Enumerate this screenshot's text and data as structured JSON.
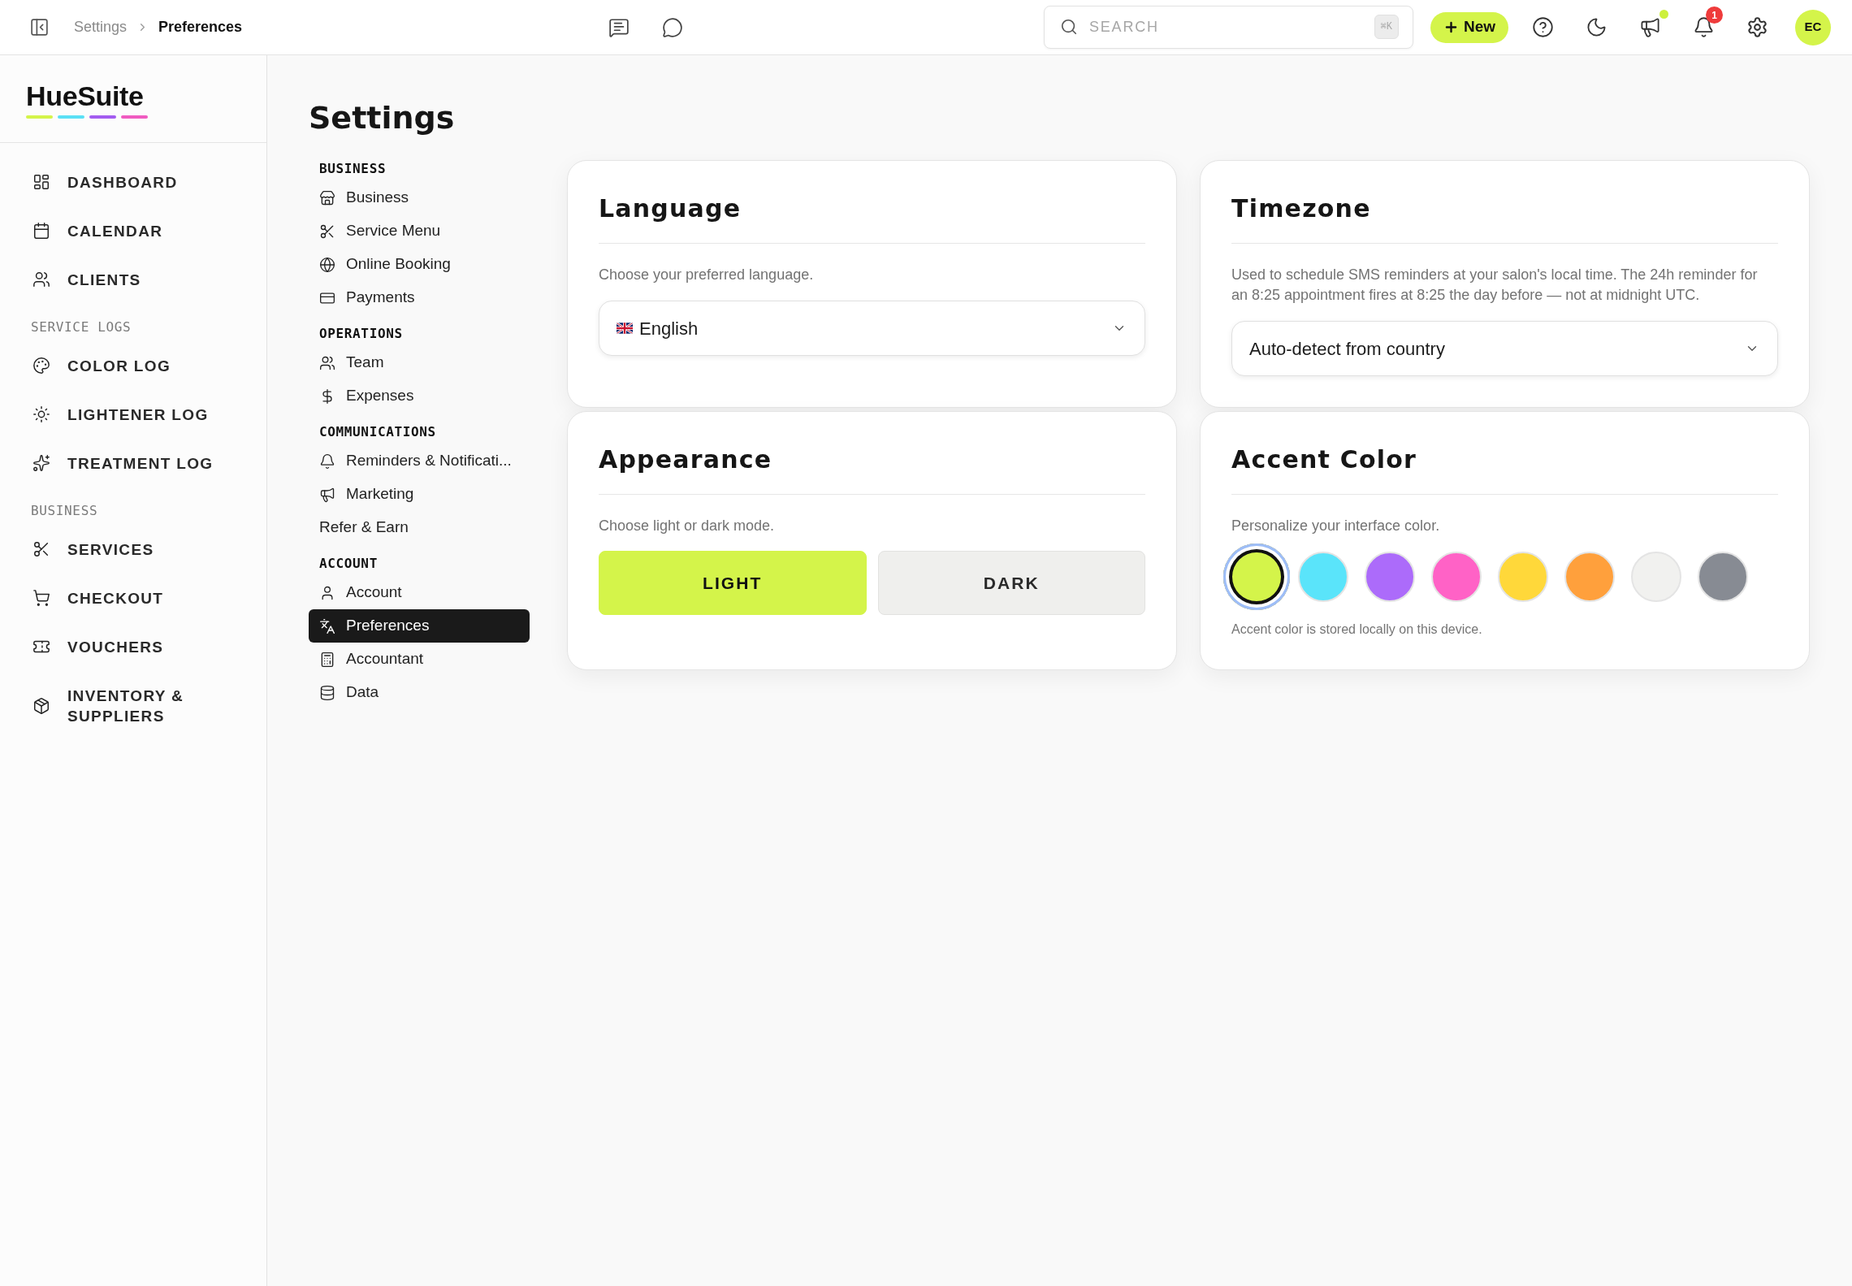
{
  "topbar": {
    "breadcrumb": [
      {
        "label": "Settings",
        "current": false
      },
      {
        "label": "Preferences",
        "current": true
      }
    ],
    "search": {
      "placeholder": "SEARCH",
      "shortcut": "⌘K"
    },
    "new_button": "New",
    "announcements": {
      "unread": true
    },
    "notifications": {
      "count": "1"
    },
    "avatar": "EC"
  },
  "sidebar": {
    "logo": "HueSuite",
    "sections": [
      {
        "items": [
          {
            "label": "DASHBOARD",
            "selected": false
          },
          {
            "label": "CALENDAR",
            "selected": false
          },
          {
            "label": "CLIENTS",
            "selected": false
          }
        ]
      },
      {
        "heading": "SERVICE LOGS",
        "items": [
          {
            "label": "COLOR LOG",
            "selected": false
          },
          {
            "label": "LIGHTENER LOG",
            "selected": false
          },
          {
            "label": "TREATMENT LOG",
            "selected": false
          }
        ]
      },
      {
        "heading": "BUSINESS",
        "items": [
          {
            "label": "SERVICES",
            "selected": false
          },
          {
            "label": "CHECKOUT",
            "selected": false
          },
          {
            "label": "VOUCHERS",
            "selected": false
          },
          {
            "label": "INVENTORY & SUPPLIERS",
            "selected": false
          }
        ]
      }
    ]
  },
  "settings": {
    "title": "Settings",
    "nav": [
      {
        "heading": "BUSINESS",
        "items": [
          {
            "label": "Business",
            "selected": false
          },
          {
            "label": "Service Menu",
            "selected": false
          },
          {
            "label": "Online Booking",
            "selected": false
          },
          {
            "label": "Payments",
            "selected": false
          }
        ]
      },
      {
        "heading": "OPERATIONS",
        "items": [
          {
            "label": "Team",
            "selected": false
          },
          {
            "label": "Expenses",
            "selected": false
          }
        ]
      },
      {
        "heading": "COMMUNICATIONS",
        "items": [
          {
            "label": "Reminders & Notificati...",
            "selected": false
          },
          {
            "label": "Marketing",
            "selected": false
          },
          {
            "label": "Refer & Earn",
            "selected": false
          }
        ]
      },
      {
        "heading": "ACCOUNT",
        "items": [
          {
            "label": "Account",
            "selected": false
          },
          {
            "label": "Preferences",
            "selected": true
          },
          {
            "label": "Accountant",
            "selected": false
          },
          {
            "label": "Data",
            "selected": false
          }
        ]
      }
    ]
  },
  "panels": [
    {
      "kind": "language",
      "title": "Language",
      "description": "Choose your preferred language.",
      "select": {
        "value": "English"
      }
    },
    {
      "kind": "timezone",
      "title": "Timezone",
      "description": "Used to schedule SMS reminders at your salon's local time. The 24h reminder for an 8:25 appointment fires at 8:25 the day before — not at midnight UTC.",
      "select": {
        "value": "Auto-detect from country"
      }
    },
    {
      "kind": "appearance",
      "title": "Appearance",
      "description": "Choose light or dark mode.",
      "options": [
        {
          "label": "LIGHT",
          "selected": true
        },
        {
          "label": "DARK",
          "selected": false
        }
      ]
    },
    {
      "kind": "accent",
      "title": "Accent Color",
      "description": "Personalize your interface color.",
      "swatches": [
        {
          "color": "#d4f44a",
          "selected": true
        },
        {
          "color": "#5ae4fa",
          "selected": false
        },
        {
          "color": "#ac6bfa",
          "selected": false
        },
        {
          "color": "#ff62c6",
          "selected": false
        },
        {
          "color": "#ffd83a",
          "selected": false
        },
        {
          "color": "#ffa03c",
          "selected": false
        },
        {
          "color": "#f1f1ef",
          "selected": false
        },
        {
          "color": "#878b93",
          "selected": false
        }
      ],
      "note": "Accent color is stored locally on this device."
    }
  ]
}
